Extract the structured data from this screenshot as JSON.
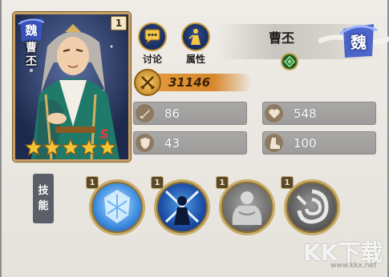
{
  "card": {
    "faction": "魏",
    "level": "1",
    "name": "曹丕",
    "stars": 5
  },
  "buttons": {
    "discuss_label": "讨论",
    "attributes_label": "属性"
  },
  "hero": {
    "name": "曹丕",
    "faction": "魏"
  },
  "power": {
    "value": "31146"
  },
  "stats": {
    "attack": "86",
    "hp": "548",
    "defense": "43",
    "speed": "100"
  },
  "skills": {
    "label_chars": [
      "技",
      "能"
    ],
    "items": [
      {
        "level": "1",
        "icon": "ice-shield-skill-icon"
      },
      {
        "level": "1",
        "icon": "crossed-swords-warrior-skill-icon"
      },
      {
        "level": "1",
        "icon": "muscle-man-skill-icon"
      },
      {
        "level": "1",
        "icon": "whirl-claw-skill-icon"
      }
    ]
  },
  "watermark": {
    "text": "KK下载",
    "url": "www.kkx.net"
  },
  "colors": {
    "card_border": "#c9a063",
    "power_bar": "#d8862a",
    "stat_box": "#a3a2a0",
    "wei_blue": "#3c58c8"
  }
}
